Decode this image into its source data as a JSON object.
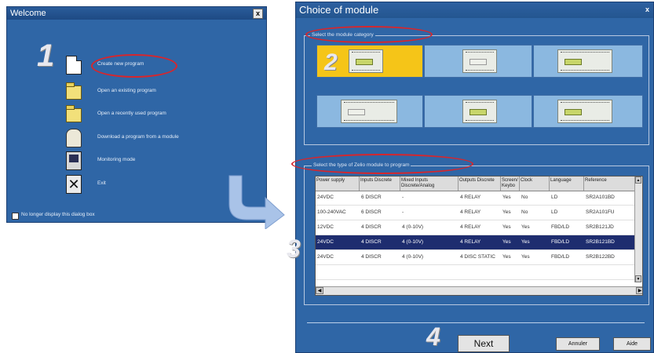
{
  "welcome": {
    "title": "Welcome",
    "close_glyph": "x",
    "step": "1",
    "items": [
      {
        "icon": "new-document-icon",
        "label": "Create new program"
      },
      {
        "icon": "open-folder-icon",
        "label": "Open an existing program"
      },
      {
        "icon": "recent-folder-icon",
        "label": "Open a recently used program"
      },
      {
        "icon": "cable-download-icon",
        "label": "Download a program from a module"
      },
      {
        "icon": "monitor-icon",
        "label": "Monitoring mode"
      },
      {
        "icon": "exit-x-icon",
        "label": "Exit"
      }
    ],
    "checkbox_label": "No longer display this dialog box"
  },
  "choice": {
    "title": "Choice of module",
    "close_glyph": "x",
    "category_label": "Select the module category",
    "step2": "2",
    "step3": "3",
    "step4": "4",
    "tiles_selected_index": 0,
    "type_label": "Select the type of Zelio module to program",
    "table": {
      "headers": [
        "Power supply",
        "Inputs Discrete",
        "Mixed Inputs Discrete/Analog",
        "Outputs Discrete",
        "Screen/ Keybo",
        "Clock",
        "Language",
        "Reference"
      ],
      "rows": [
        [
          "24VDC",
          "6 DISCR",
          "-",
          "4 RELAY",
          "Yes",
          "No",
          "LD",
          "SR2A101BD"
        ],
        [
          "100-240VAC",
          "6 DISCR",
          "-",
          "4 RELAY",
          "Yes",
          "No",
          "LD",
          "SR2A101FU"
        ],
        [
          "12VDC",
          "4 DISCR",
          "4 (0-10V)",
          "4 RELAY",
          "Yes",
          "Yes",
          "FBD/LD",
          "SR2B121JD"
        ],
        [
          "24VDC",
          "4 DISCR",
          "4 (0-10V)",
          "4 RELAY",
          "Yes",
          "Yes",
          "FBD/LD",
          "SR2B121BD"
        ],
        [
          "24VDC",
          "4 DISCR",
          "4 (0-10V)",
          "4 DISC STATIC",
          "Yes",
          "Yes",
          "FBD/LD",
          "SR2B122BD"
        ],
        [
          "",
          "",
          "",
          "",
          "",
          "",
          "",
          ""
        ]
      ],
      "selected_row": 3
    },
    "next_label": "Next",
    "cancel_label": "Annuler",
    "help_label": "Aide"
  },
  "colors": {
    "dialog_bg": "#2f66a6",
    "highlight_oval": "#d7262c",
    "selected_tile": "#f5c518",
    "selected_row": "#1e2d6f"
  }
}
